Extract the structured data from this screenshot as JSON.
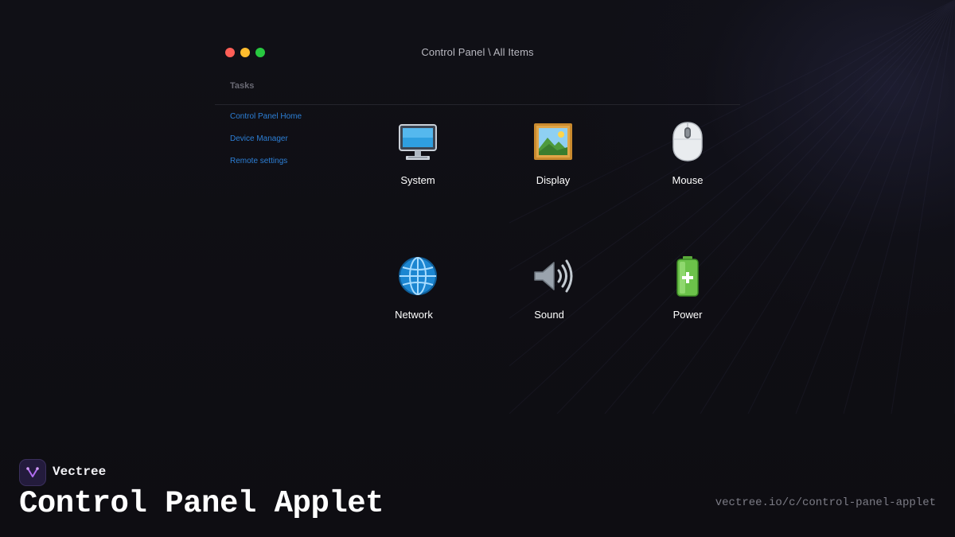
{
  "window": {
    "title": "Control Panel \\ All Items"
  },
  "sidebar": {
    "heading": "Tasks",
    "links": [
      {
        "label": "Control Panel Home"
      },
      {
        "label": "Device Manager"
      },
      {
        "label": "Remote settings"
      }
    ]
  },
  "applets": [
    {
      "label": "System",
      "icon": "monitor-icon"
    },
    {
      "label": "Display",
      "icon": "picture-icon"
    },
    {
      "label": "Mouse",
      "icon": "mouse-icon"
    },
    {
      "label": "Network",
      "icon": "globe-icon"
    },
    {
      "label": "Sound",
      "icon": "speaker-icon"
    },
    {
      "label": "Power",
      "icon": "battery-icon"
    }
  ],
  "branding": {
    "name": "Vectree",
    "heading": "Control Panel Applet",
    "url": "vectree.io/c/control-panel-applet"
  },
  "colors": {
    "background": "#0f0e13",
    "link": "#2d7fd6",
    "close": "#ff5f57",
    "minimize": "#febc2e",
    "maximize": "#28c840"
  }
}
